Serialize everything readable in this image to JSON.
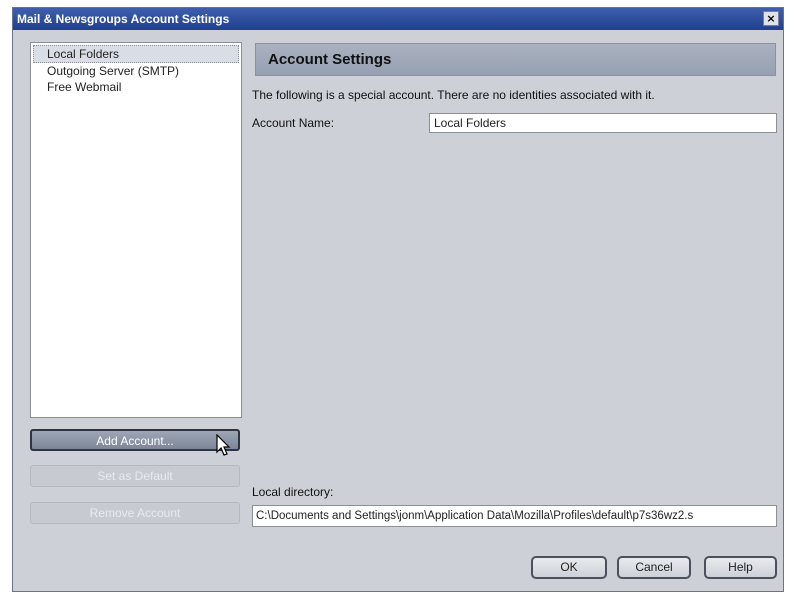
{
  "window": {
    "title": "Mail & Newsgroups Account Settings",
    "close_label": "×"
  },
  "accounts": {
    "items": [
      {
        "label": "Local Folders"
      },
      {
        "label": "Outgoing Server (SMTP)"
      },
      {
        "label": "Free Webmail"
      }
    ],
    "add_label": "Add Account...",
    "default_label": "Set as Default",
    "remove_label": "Remove Account"
  },
  "panel": {
    "title": "Account Settings",
    "info": "The following is a special account. There are no identities associated with it.",
    "name_label": "Account Name:",
    "name_value": "Local Folders",
    "dir_label": "Local directory:",
    "dir_value": "C:\\Documents and Settings\\jonm\\Application Data\\Mozilla\\Profiles\\default\\p7s36wz2.s"
  },
  "buttons": {
    "ok": "OK",
    "cancel": "Cancel",
    "help": "Help"
  }
}
